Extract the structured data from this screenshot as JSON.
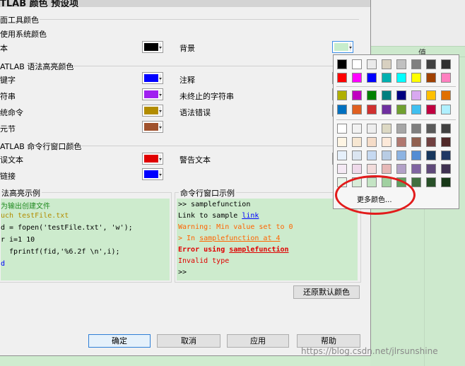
{
  "dialog": {
    "title": "TLAB 颜色 预设项",
    "sections": {
      "desktop": {
        "title": "面工具颜色",
        "use_system": "使用系统颜色",
        "text_label": "本",
        "bg_label": "背景"
      },
      "syntax": {
        "title": "ATLAB 语法高亮颜色",
        "keyword": "键字",
        "comment": "注释",
        "string": "符串",
        "unterminated": "未终止的字符串",
        "syscmd": "统命令",
        "syntax_error": "语法错误",
        "cell": "元节"
      },
      "cmdwin": {
        "title": "ATLAB 命令行窗口颜色",
        "error_text": "误文本",
        "warning_text": "警告文本",
        "hyperlink": "链接"
      }
    },
    "colors": {
      "text": "#000000",
      "background": "#c7edcc",
      "keyword": "#0000ff",
      "comment": "#228b22",
      "string": "#a020f0",
      "unterminated": "#b20000",
      "syscmd": "#b28c00",
      "syntax_error": "#ff0000",
      "cell": "#a0522d",
      "error_text": "#e00000",
      "warning_text": "#ff6400",
      "hyperlink": "#0000ff"
    },
    "syntax_sample": {
      "title": "法高亮示例",
      "lines": [
        {
          "text": "为输出创建文件",
          "color": "#228b22"
        },
        {
          "text": "uch testFile.txt",
          "color": "#b28c00"
        },
        {
          "text": "d = fopen('testFile.txt', 'w');",
          "color": "#000000"
        },
        {
          "text": "r i=1 10",
          "color": "#000000"
        },
        {
          "text": "  fprintf(fid,'%6.2f \\n',i);",
          "color": "#000000"
        },
        {
          "text": "d",
          "color": "#0000ff"
        }
      ]
    },
    "cmd_sample": {
      "title": "命令行窗口示例",
      "line1": ">> samplefunction",
      "line2_prefix": "Link to sample ",
      "line2_link": "link",
      "line3": "Warning: Min value set to 0",
      "line4_prefix": "> In ",
      "line4_link": "samplefunction at 4",
      "line5_prefix": "Error using ",
      "line5_link": "samplefunction",
      "line6": "Invalid type",
      "line7": ">>"
    },
    "restore_button": "还原默认颜色",
    "buttons": {
      "ok": "确定",
      "cancel": "取消",
      "apply": "应用",
      "help": "帮助"
    }
  },
  "background_window": {
    "header_fragment": "值"
  },
  "color_picker": {
    "row1": [
      "#000000",
      "#ffffff",
      "#eaeaea",
      "#d8d0c0",
      "#c0c0c0",
      "#808080",
      "#404040",
      "#303030"
    ],
    "row2": [
      "#ff0000",
      "#ff00ff",
      "#0000ff",
      "#00b0b0",
      "#00ffff",
      "#ffff00",
      "#a04000",
      "#ff80c0"
    ],
    "row3": [
      "#b0b000",
      "#c000c0",
      "#008000",
      "#008080",
      "#000080",
      "#d8a8f0",
      "#ffc000",
      "#e07000"
    ],
    "row4": [
      "#0070c0",
      "#e06020",
      "#d03030",
      "#7030a0",
      "#70a030",
      "#40c0f0",
      "#c00040",
      "#b0f0ff"
    ],
    "tints": [
      [
        "#ffffff",
        "#f2f2f2",
        "#eeeeee",
        "#ddd9c4",
        "#a6a6a6",
        "#7f7f7f",
        "#595959",
        "#404040"
      ],
      [
        "#fef5e4",
        "#f7e7d2",
        "#f5dcc8",
        "#fde9d9",
        "#b07870",
        "#906050",
        "#704040",
        "#502828"
      ],
      [
        "#e6f0fb",
        "#dbe5f1",
        "#c6d9f1",
        "#b8cce4",
        "#8db3e2",
        "#548dd4",
        "#17365d",
        "#1f3864"
      ],
      [
        "#f4e9f4",
        "#efd9ea",
        "#f2dcdb",
        "#e6b8b7",
        "#b2a1c7",
        "#8064a2",
        "#5f497a",
        "#3f3151"
      ],
      [
        "#e8f4e8",
        "#d8ecd8",
        "#c4e4c4",
        "#a0d0a0",
        "#60a060",
        "#407040",
        "#285028",
        "#183818"
      ]
    ],
    "more_colors": "更多颜色..."
  },
  "watermark": "https://blog.csdn.net/jlrsunshine"
}
